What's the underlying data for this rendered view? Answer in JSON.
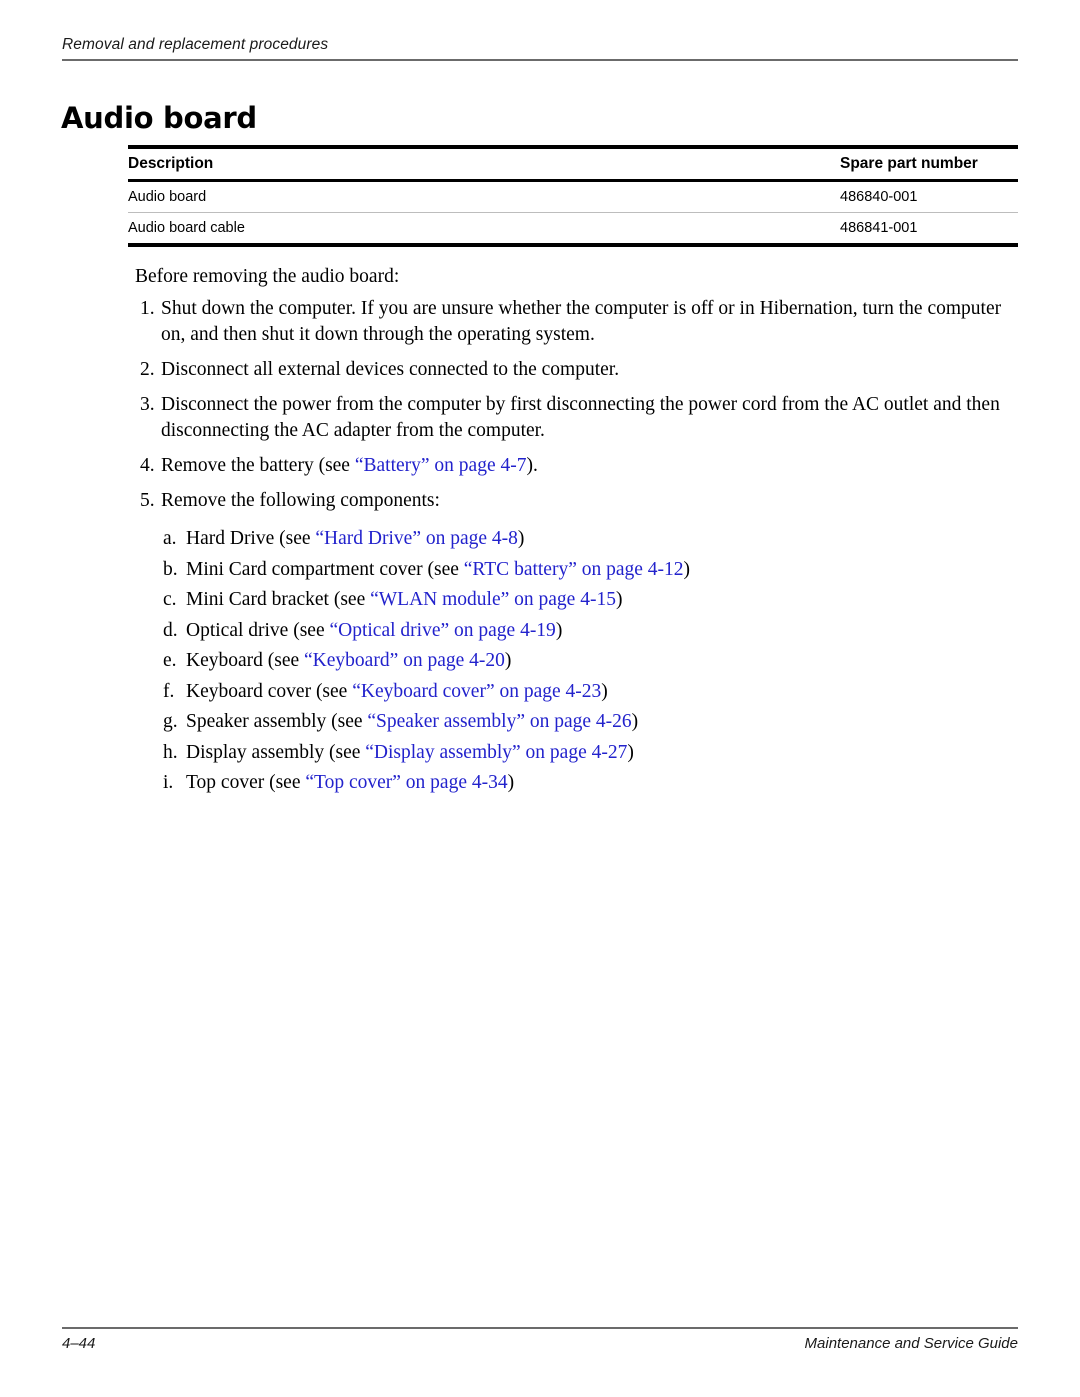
{
  "colors": {
    "text": "#000000",
    "crossreference_link": "#2222cc",
    "rule": "#6b6b6b",
    "table_rule": "#000000",
    "table_row_separator": "#bdbdbd"
  },
  "running_header": {
    "text": "Removal and replacement procedures"
  },
  "section": {
    "title": "Audio board"
  },
  "parts_table": {
    "columns": [
      "Description",
      "Spare part number"
    ],
    "rows": [
      {
        "description": "Audio board",
        "spare_part_number": "486840-001"
      },
      {
        "description": "Audio board cable",
        "spare_part_number": "486841-001"
      }
    ]
  },
  "body": {
    "intro": "Before removing the audio board:",
    "steps": [
      {
        "marker": "1.",
        "text": "Shut down the computer. If you are unsure whether the computer is off or in Hibernation, turn the computer on, and then shut it down through the operating system."
      },
      {
        "marker": "2.",
        "text": "Disconnect all external devices connected to the computer."
      },
      {
        "marker": "3.",
        "text": "Disconnect the power from the computer by first disconnecting the power cord from the AC outlet and then disconnecting the AC adapter from the computer."
      },
      {
        "marker": "4.",
        "text_before": "Remove the battery (see ",
        "link": "“Battery” on page 4-7",
        "text_after": ")."
      },
      {
        "marker": "5.",
        "text": "Remove the following components:"
      }
    ],
    "substeps": [
      {
        "marker": "a.",
        "text_before": "Hard Drive (see ",
        "link": "“Hard Drive” on page 4-8",
        "text_after": ")"
      },
      {
        "marker": "b.",
        "text_before": "Mini Card compartment cover (see ",
        "link": "“RTC battery” on page 4-12",
        "text_after": ")"
      },
      {
        "marker": "c.",
        "text_before": "Mini Card bracket (see ",
        "link": "“WLAN module” on page 4-15",
        "text_after": ")"
      },
      {
        "marker": "d.",
        "text_before": "Optical drive (see ",
        "link": "“Optical drive” on page 4-19",
        "text_after": ")"
      },
      {
        "marker": "e.",
        "text_before": "Keyboard (see ",
        "link": "“Keyboard” on page 4-20",
        "text_after": ")"
      },
      {
        "marker": "f.",
        "text_before": "Keyboard cover (see ",
        "link": "“Keyboard cover” on page 4-23",
        "text_after": ")"
      },
      {
        "marker": "g.",
        "text_before": "Speaker assembly (see ",
        "link": "“Speaker assembly” on page 4-26",
        "text_after": ")"
      },
      {
        "marker": "h.",
        "text_before": "Display assembly (see ",
        "link": "“Display assembly” on page 4-27",
        "text_after": ")"
      },
      {
        "marker": "i.",
        "text_before": "Top cover (see ",
        "link": "“Top cover” on page 4-34",
        "text_after": ")"
      }
    ]
  },
  "footer": {
    "page_number": "4–44",
    "guide_title": "Maintenance and Service Guide"
  }
}
